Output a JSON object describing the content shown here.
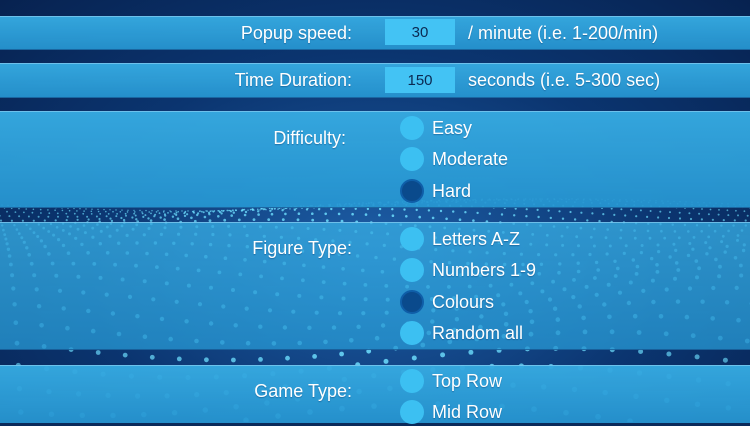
{
  "settings": {
    "popup_speed": {
      "label": "Popup speed:",
      "value": "30",
      "hint": "/ minute (i.e. 1-200/min)"
    },
    "time_duration": {
      "label": "Time Duration:",
      "value": "150",
      "hint": "seconds (i.e. 5-300 sec)"
    },
    "difficulty": {
      "label": "Difficulty:",
      "options": [
        {
          "label": "Easy",
          "selected": false
        },
        {
          "label": "Moderate",
          "selected": false
        },
        {
          "label": "Hard",
          "selected": true
        }
      ]
    },
    "figure_type": {
      "label": "Figure Type:",
      "options": [
        {
          "label": "Letters A-Z",
          "selected": false
        },
        {
          "label": "Numbers 1-9",
          "selected": false
        },
        {
          "label": "Colours",
          "selected": true
        },
        {
          "label": "Random all",
          "selected": false
        }
      ]
    },
    "game_type": {
      "label": "Game Type:",
      "options": [
        {
          "label": "Top Row",
          "selected": false
        },
        {
          "label": "Mid Row",
          "selected": false
        }
      ]
    }
  },
  "colors": {
    "band": "#2a9fd8",
    "radio_unselected": "#3cc0f2",
    "radio_selected": "#0a4a8c",
    "input_bg": "#43c3f4",
    "background": "#0b3570"
  }
}
